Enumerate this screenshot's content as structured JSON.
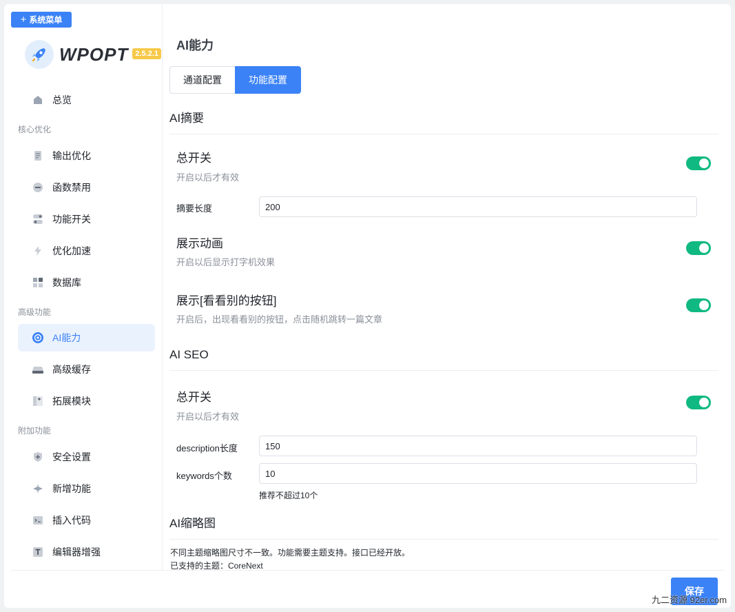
{
  "sidebar": {
    "system_menu_label": "系统菜单",
    "logo_text": "WPOPT",
    "version": "2.5.2.1",
    "items": [
      {
        "label": "总览",
        "icon": "home-icon"
      },
      {
        "label": "输出优化",
        "icon": "document-icon"
      },
      {
        "label": "函数禁用",
        "icon": "minus-circle-icon"
      },
      {
        "label": "功能开关",
        "icon": "toggle-icon"
      },
      {
        "label": "优化加速",
        "icon": "lightning-icon"
      },
      {
        "label": "数据库",
        "icon": "grid-icon"
      },
      {
        "label": "AI能力",
        "icon": "ai-icon"
      },
      {
        "label": "高级缓存",
        "icon": "drive-icon"
      },
      {
        "label": "拓展模块",
        "icon": "extension-icon"
      },
      {
        "label": "安全设置",
        "icon": "shield-icon"
      },
      {
        "label": "新增功能",
        "icon": "sparkle-icon"
      },
      {
        "label": "插入代码",
        "icon": "code-icon"
      },
      {
        "label": "编辑器增强",
        "icon": "text-icon"
      }
    ],
    "groups": {
      "core": "核心优化",
      "advanced": "高级功能",
      "extra": "附加功能"
    }
  },
  "main": {
    "title": "AI能力",
    "tabs": [
      {
        "label": "通道配置",
        "active": false
      },
      {
        "label": "功能配置",
        "active": true
      }
    ],
    "summary": {
      "title": "AI摘要",
      "master_switch": {
        "title": "总开关",
        "desc": "开启以后才有效",
        "on": true
      },
      "length_label": "摘要长度",
      "length_value": "200",
      "animation": {
        "title": "展示动画",
        "desc": "开启以后显示打字机效果",
        "on": true
      },
      "see_other": {
        "title": "展示[看看别的按钮]",
        "desc": "开启后，出现看看别的按钮，点击随机跳转一篇文章",
        "on": true
      }
    },
    "seo": {
      "title": "AI SEO",
      "master_switch": {
        "title": "总开关",
        "desc": "开启以后才有效",
        "on": true
      },
      "description_label": "description长度",
      "description_value": "150",
      "keywords_label": "keywords个数",
      "keywords_value": "10",
      "keywords_hint": "推荐不超过10个"
    },
    "thumbnail": {
      "title": "AI缩略图",
      "note_1": "不同主题缩略图尺寸不一致。功能需要主题支持。接口已经开放。",
      "note_2": "已支持的主题：CoreNext"
    }
  },
  "footer": {
    "save_label": "保存",
    "watermark": "九二资源 92er.com"
  },
  "colors": {
    "accent": "#3b82f6",
    "switch_on": "#10b981",
    "badge": "#f7c948"
  }
}
